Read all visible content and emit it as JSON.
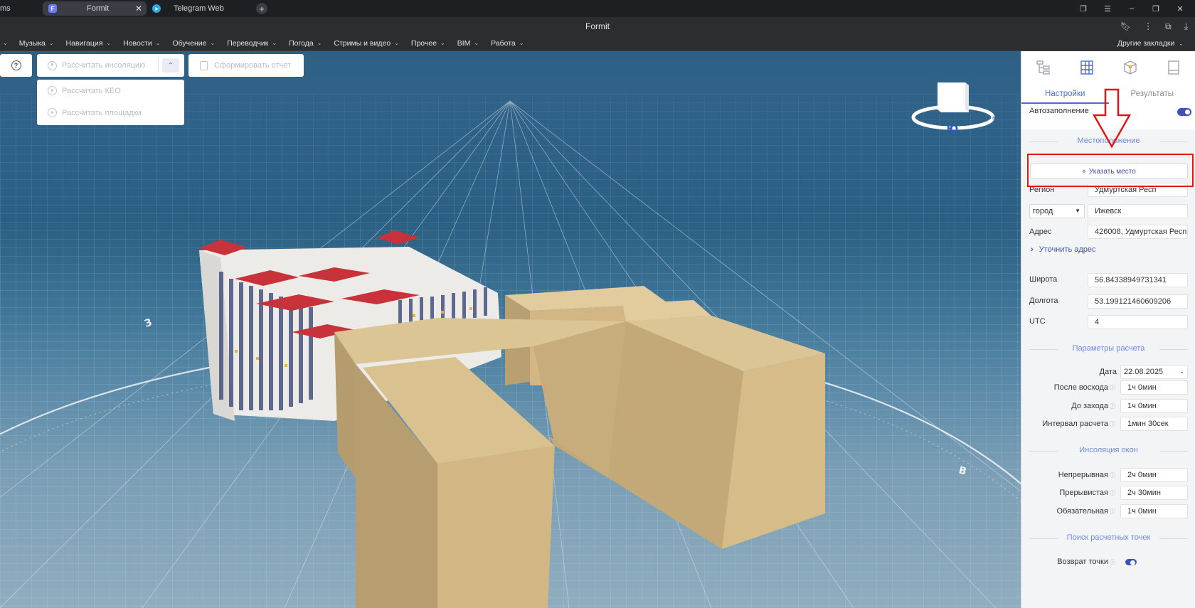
{
  "browser": {
    "tabs": [
      {
        "label": "ms"
      },
      {
        "label": "Formit",
        "favicon": "F"
      },
      {
        "label": "Telegram Web"
      }
    ],
    "window_title": "Formit",
    "bookmarks": [
      "Музыка",
      "Навигация",
      "Новости",
      "Обучение",
      "Переводчик",
      "Погода",
      "Стримы и видео",
      "Прочее",
      "BIM",
      "Работа"
    ],
    "other_bookmarks": "Другие закладки"
  },
  "toolbar": {
    "help": "?",
    "calc_insolation": "Рассчитать инсоляцию",
    "report": "Сформировать отчет",
    "dropdown": [
      "Рассчитать КЕО",
      "Рассчитать площадки"
    ]
  },
  "compass": {
    "south_label": "Ю",
    "west_label": "З",
    "east_label": "В"
  },
  "panel": {
    "tabs": [
      "Настройки",
      "Результаты"
    ],
    "autofill_label": "Автозаполнение",
    "autofill_on": true,
    "location_section": "Местоположение",
    "set_location_btn": "Указать место",
    "region_label": "Регион",
    "region_value": "Удмуртская Респ",
    "settlement_type": "город",
    "city_value": "Ижевск",
    "address_label": "Адрес",
    "address_value": "426008, Удмуртская Респ",
    "refine_address": "Уточнить адрес",
    "lat_label": "Широта",
    "lat_value": "56.84338949731341",
    "lon_label": "Долгота",
    "lon_value": "53.199121460609206",
    "utc_label": "UTC",
    "utc_value": "4",
    "calc_section": "Параметры расчета",
    "date_label": "Дата",
    "date_value": "22.08.2025",
    "after_sunrise_label": "После восхода",
    "after_sunrise_value": "1ч 0мин",
    "before_sunset_label": "До захода",
    "before_sunset_value": "1ч 0мин",
    "interval_label": "Интервал расчета",
    "interval_value": "1мин 30сек",
    "window_section": "Инсоляция окон",
    "continuous_label": "Непрерывная",
    "continuous_value": "2ч 0мин",
    "interrupted_label": "Прерывистая",
    "interrupted_value": "2ч 30мин",
    "mandatory_label": "Обязательная",
    "mandatory_value": "1ч 0мин",
    "points_section": "Поиск расчетных точек",
    "return_point_label": "Возврат точки",
    "return_point_on": true
  },
  "colors": {
    "accent": "#3f51b5",
    "annotation_red": "#e01717",
    "roof_red": "#c8323a",
    "massing_tan": "#d2b784"
  }
}
